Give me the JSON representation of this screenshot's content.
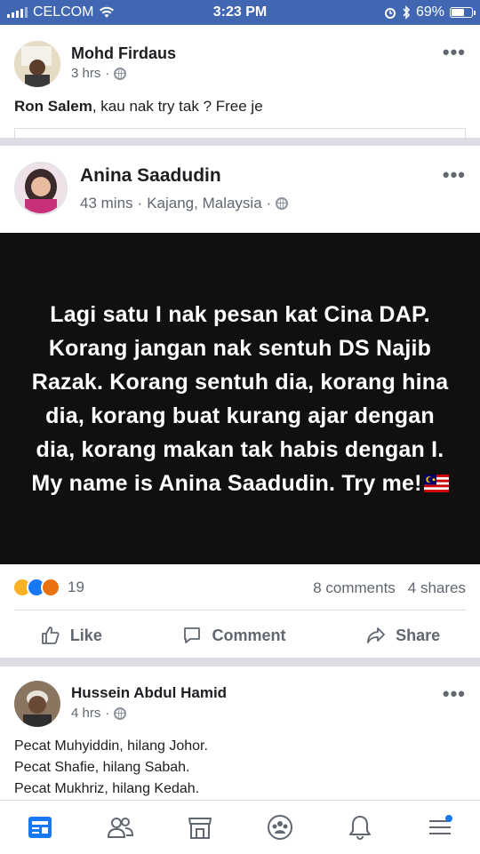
{
  "status_bar": {
    "carrier": "CELCOM",
    "time": "3:23 PM",
    "battery_percent_label": "69%",
    "battery_level": 0.69
  },
  "post1": {
    "author": "Mohd Firdaus",
    "time": "3 hrs",
    "tagged": "Ron Salem",
    "comment_text": ", kau nak try tak ? Free je"
  },
  "post2": {
    "author": "Anina Saadudin",
    "time": "43 mins",
    "location": "Kajang, Malaysia",
    "image_text": "Lagi satu I nak pesan kat Cina DAP. Korang jangan nak sentuh DS Najib Razak. Korang sentuh dia, korang hina dia, korang buat kurang ajar dengan dia, korang makan tak habis dengan I. My name is Anina Saadudin. Try me!",
    "reaction_count": "19",
    "comments": "8 comments",
    "shares": "4 shares",
    "actions": {
      "like": "Like",
      "comment": "Comment",
      "share": "Share"
    }
  },
  "post3": {
    "author": "Hussein Abdul Hamid",
    "time": "4 hrs",
    "lines": [
      "Pecat Muhyiddin, hilang Johor.",
      "Pecat Shafie, hilang Sabah.",
      "Pecat Mukhriz, hilang Kedah."
    ]
  },
  "icons": {
    "nav": [
      "news-feed-icon",
      "friends-icon",
      "marketplace-icon",
      "groups-icon",
      "notifications-icon",
      "menu-icon"
    ]
  },
  "colors": {
    "brand": "#4267b2",
    "accent": "#1877f2"
  }
}
